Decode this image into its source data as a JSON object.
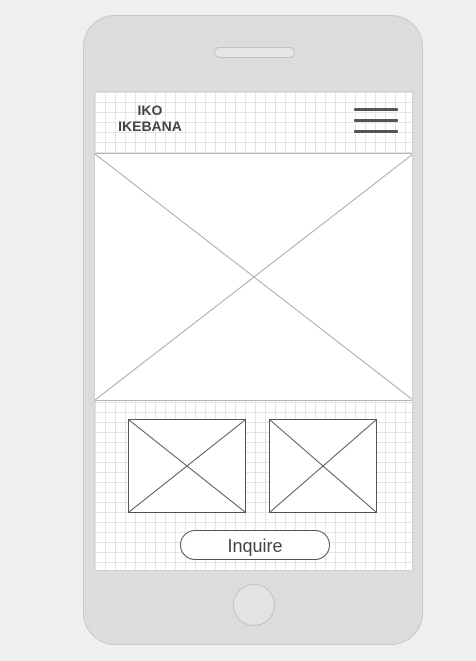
{
  "header": {
    "logo_line1": "IKO",
    "logo_line2": "IKEBANA",
    "menu_icon": "hamburger-menu-icon"
  },
  "content": {
    "hero_image": "image-placeholder",
    "thumbnails": [
      "image-placeholder",
      "image-placeholder"
    ]
  },
  "actions": {
    "inquire_label": "Inquire"
  },
  "colors": {
    "background": "#efefef",
    "device": "#dcdcdc",
    "screen": "#ffffff",
    "grid": "#e4e4e4",
    "text": "#444444",
    "stroke": "#555555"
  }
}
